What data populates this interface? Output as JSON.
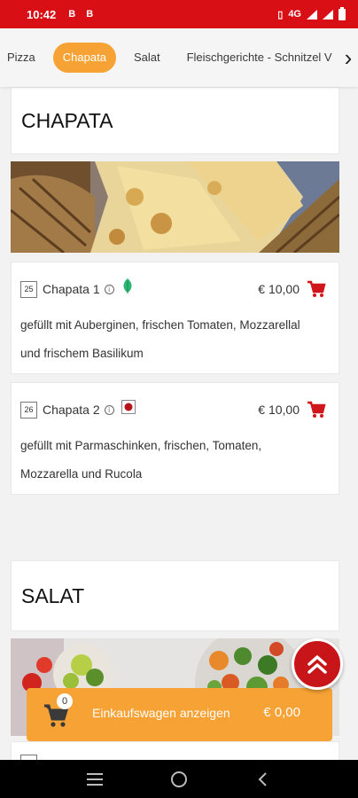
{
  "status_bar": {
    "time": "10:42",
    "notif_1": "B",
    "notif_2": "B",
    "network": "4G"
  },
  "tabs": [
    {
      "label": "Pizza"
    },
    {
      "label": "Chapata"
    },
    {
      "label": "Salat"
    },
    {
      "label": "Fleischgerichte - Schnitzel V"
    }
  ],
  "colors": {
    "brand_red": "#d90f16",
    "accent_orange": "#f7a234"
  },
  "sections": {
    "chapata": {
      "title": "CHAPATA"
    },
    "salat": {
      "title": "SALAT"
    }
  },
  "items": [
    {
      "number": "25",
      "name": "Chapata 1",
      "price": "€ 10,00",
      "description_lines": [
        "gefüllt mit Auberginen, frischen Tomaten, Mozzarellal",
        "und frischem Basilikum"
      ],
      "badge_icon": "vegetarian-leaf-icon"
    },
    {
      "number": "26",
      "name": "Chapata 2",
      "price": "€ 10,00",
      "description_lines": [
        "gefüllt mit Parmaschinken, frischen, Tomaten,",
        "Mozzarella und Rucola"
      ],
      "badge_icon": "pork-marker-icon"
    }
  ],
  "cart": {
    "count": "0",
    "label": "Einkaufswagen anzeigen",
    "total": "€ 0,00"
  }
}
